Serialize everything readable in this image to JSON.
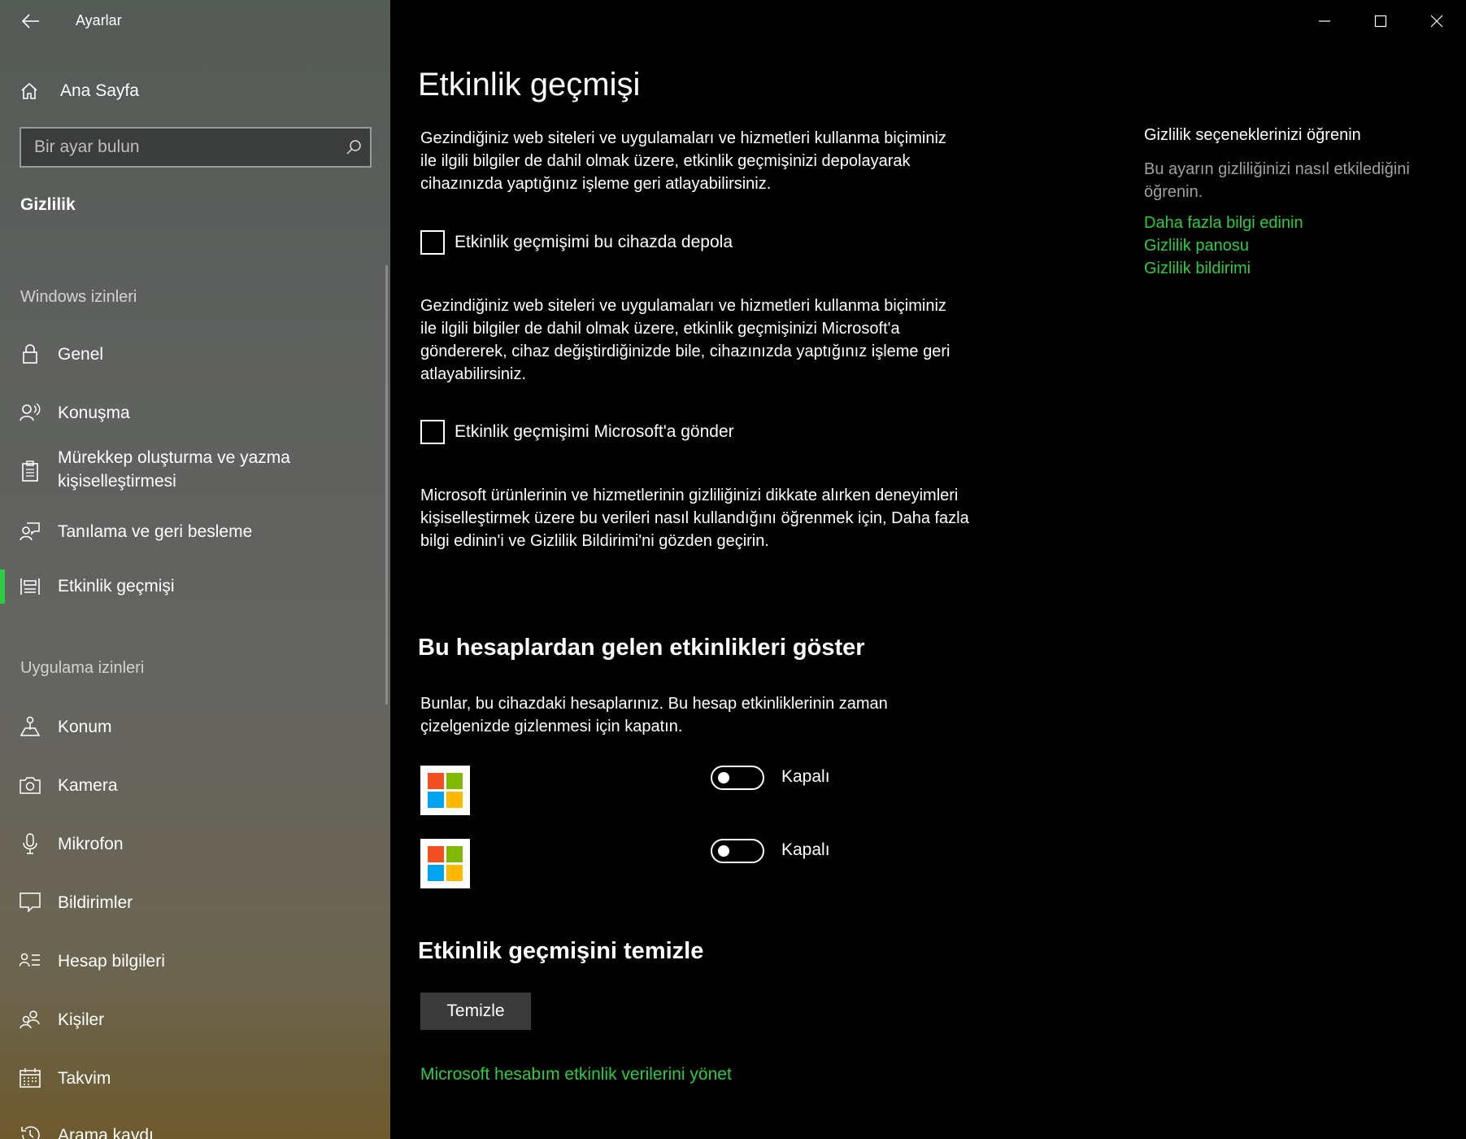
{
  "window": {
    "title": "Ayarlar",
    "controls": {
      "minimize": "minimize-icon",
      "maximize": "maximize-icon",
      "close": "close-icon"
    }
  },
  "sidebar": {
    "home_label": "Ana Sayfa",
    "search_placeholder": "Bir ayar bulun",
    "section_title": "Gizlilik",
    "group_windows": "Windows izinleri",
    "group_apps": "Uygulama izinleri",
    "windows_items": [
      {
        "label": "Genel",
        "icon": "lock-icon"
      },
      {
        "label": "Konuşma",
        "icon": "speech-icon"
      },
      {
        "label": "Mürekkep oluşturma ve yazma kişiselleştirmesi",
        "icon": "clipboard-icon"
      },
      {
        "label": "Tanılama ve geri besleme",
        "icon": "feedback-icon"
      },
      {
        "label": "Etkinlik geçmişi",
        "icon": "timeline-icon",
        "active": true
      }
    ],
    "app_items": [
      {
        "label": "Konum",
        "icon": "location-icon"
      },
      {
        "label": "Kamera",
        "icon": "camera-icon"
      },
      {
        "label": "Mikrofon",
        "icon": "microphone-icon"
      },
      {
        "label": "Bildirimler",
        "icon": "notification-icon"
      },
      {
        "label": "Hesap bilgileri",
        "icon": "account-info-icon"
      },
      {
        "label": "Kişiler",
        "icon": "people-icon"
      },
      {
        "label": "Takvim",
        "icon": "calendar-icon"
      },
      {
        "label": "Arama kaydı",
        "icon": "history-icon"
      }
    ],
    "accent_color": "#2ecc40"
  },
  "main": {
    "title": "Etkinlik geçmişi",
    "para1": "Gezindiğiniz web siteleri ve uygulamaları ve hizmetleri kullanma biçiminiz ile ilgili bilgiler de dahil olmak üzere, etkinlik geçmişinizi depolayarak cihazınızda yaptığınız işleme geri atlayabilirsiniz.",
    "check1_label": "Etkinlik geçmişimi bu cihazda depola",
    "para2": "Gezindiğiniz web siteleri ve uygulamaları ve hizmetleri kullanma biçiminiz ile ilgili bilgiler de dahil olmak üzere, etkinlik geçmişinizi Microsoft'a göndererek, cihaz değiştirdiğinizde bile, cihazınızda yaptığınız işleme geri atlayabilirsiniz.",
    "check2_label": "Etkinlik geçmişimi Microsoft'a gönder",
    "para3": "Microsoft ürünlerinin ve hizmetlerinin gizliliğinizi dikkate alırken deneyimleri kişiselleştirmek üzere bu verileri nasıl kullandığını öğrenmek için, Daha fazla bilgi edinin'i ve Gizlilik Bildirimi'ni gözden geçirin.",
    "accounts_title": "Bu hesaplardan gelen etkinlikleri göster",
    "accounts_desc": "Bunlar, bu cihazdaki hesaplarınız. Bu hesap etkinliklerinin zaman çizelgenizde gizlenmesi için kapatın.",
    "accounts": [
      {
        "toggle_label": "Kapalı",
        "state": "off"
      },
      {
        "toggle_label": "Kapalı",
        "state": "off"
      }
    ],
    "clear_title": "Etkinlik geçmişini temizle",
    "clear_button": "Temizle",
    "manage_link": "Microsoft hesabım etkinlik verilerini yönet"
  },
  "right": {
    "title": "Gizlilik seçeneklerinizi öğrenin",
    "desc": "Bu ayarın gizliliğinizi nasıl etkilediğini öğrenin.",
    "links": [
      "Daha fazla bilgi edinin",
      "Gizlilik panosu",
      "Gizlilik bildirimi"
    ]
  },
  "ms_logo_colors": [
    "#f25022",
    "#7fba00",
    "#00a4ef",
    "#ffb900"
  ]
}
